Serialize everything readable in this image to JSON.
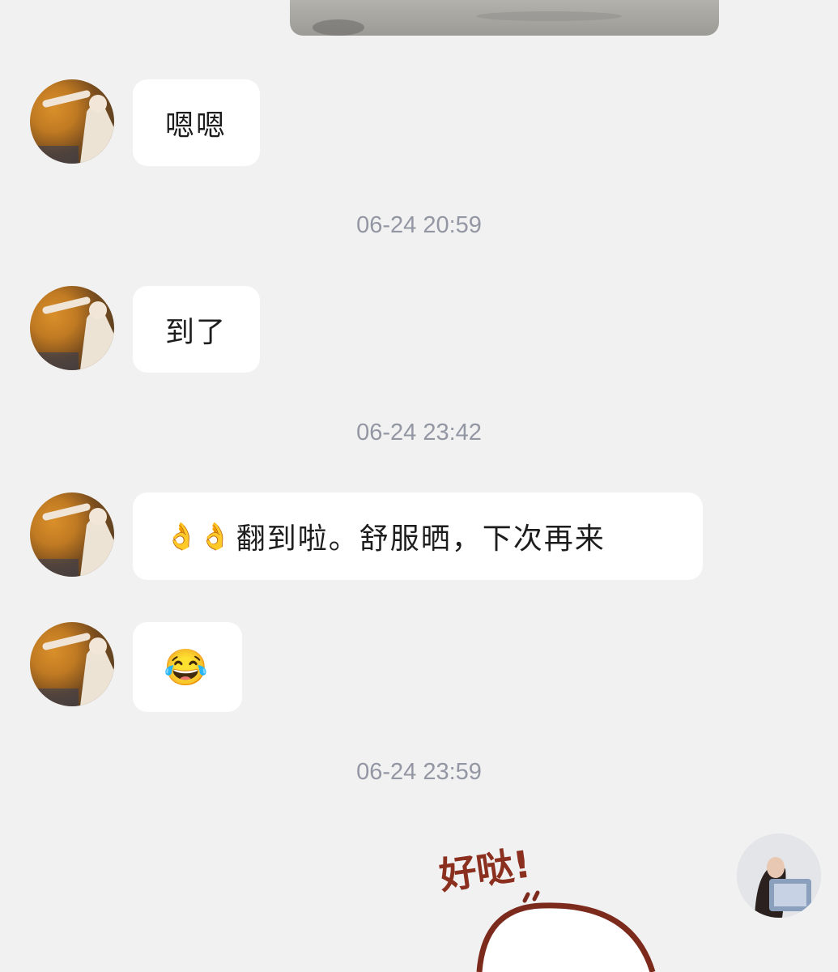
{
  "messages": {
    "m1": {
      "text": "嗯嗯"
    },
    "ts1": "06-24 20:59",
    "m2": {
      "text": "到了"
    },
    "ts2": "06-24 23:42",
    "m3": {
      "emoji": "👌👌",
      "text": "翻到啦。舒服晒，下次再来"
    },
    "m4": {
      "emoji": "😂"
    },
    "ts3": "06-24 23:59",
    "sticker": {
      "text": "好哒!"
    }
  },
  "colors": {
    "background": "#f1f1f1",
    "bubble": "#ffffff",
    "timestamp": "#9396a3",
    "sticker_text": "#8b2f1f"
  }
}
